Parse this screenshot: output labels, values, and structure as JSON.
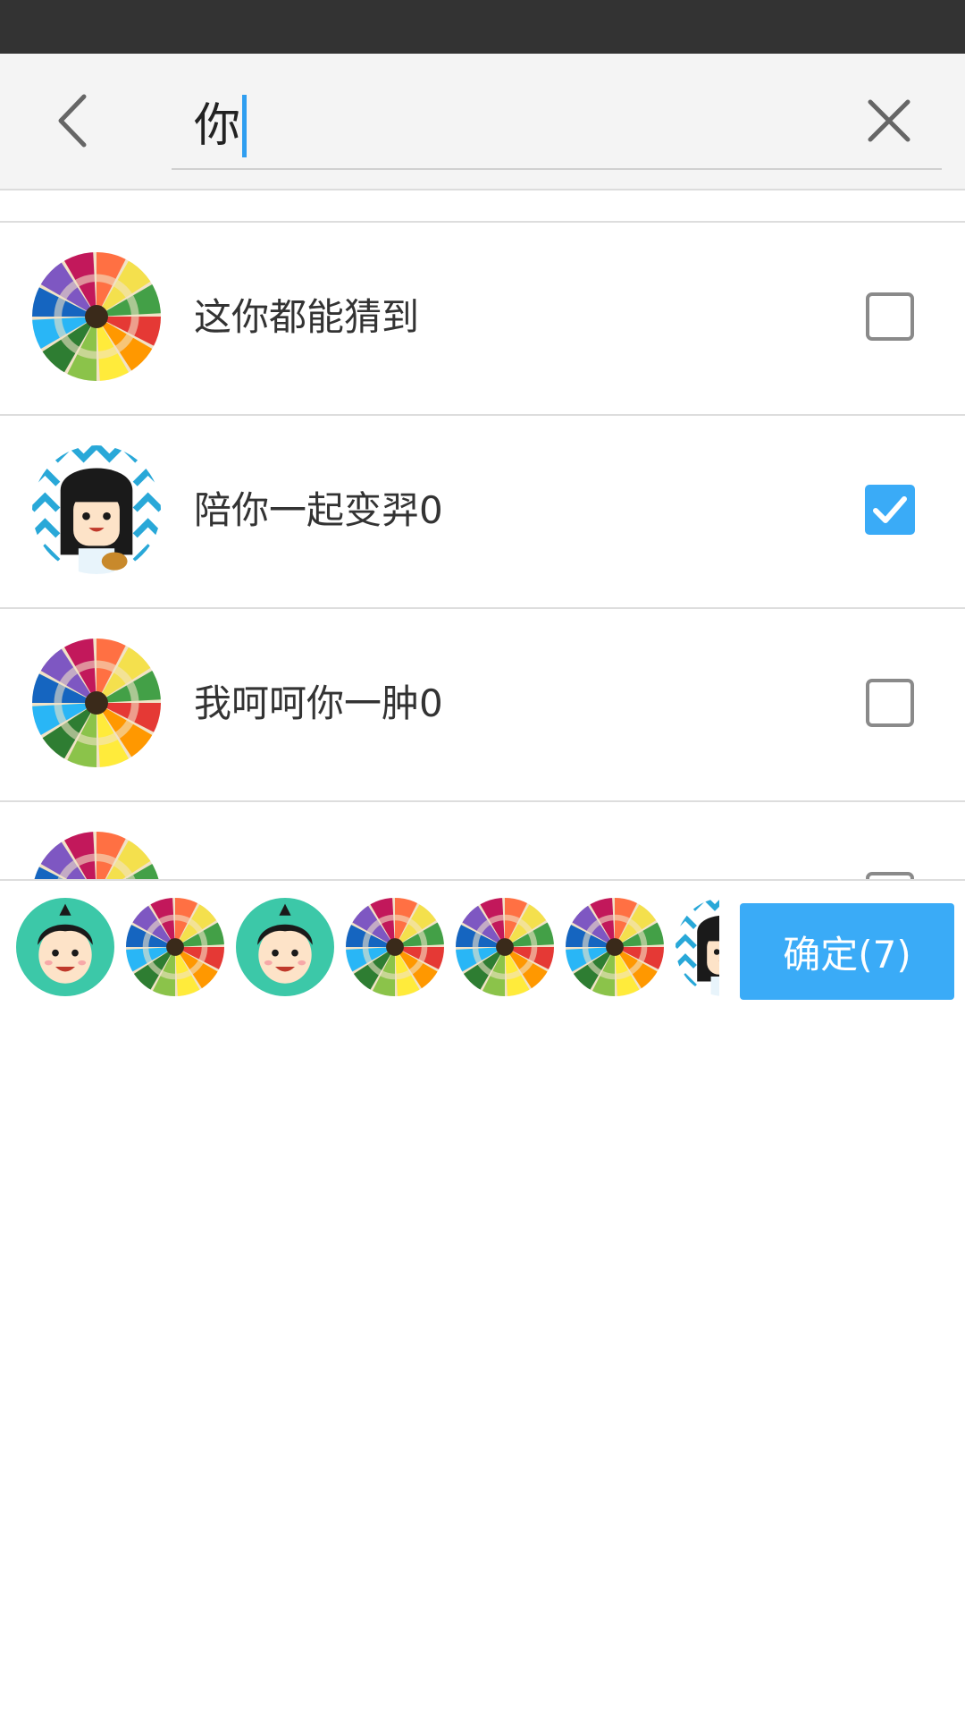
{
  "search": {
    "value": "你"
  },
  "results": [
    {
      "name": "这你都能猜到",
      "avatar": "pencil-wheel-avatar",
      "checked": false
    },
    {
      "name": "陪你一起变羿0",
      "avatar": "cartoon-girl-avatar",
      "checked": true
    },
    {
      "name": "我呵呵你一肿0",
      "avatar": "pencil-wheel-avatar",
      "checked": false
    },
    {
      "name": "",
      "avatar": "pencil-wheel-avatar",
      "checked": false
    }
  ],
  "selected": {
    "avatars": [
      "cartoon-boy-avatar",
      "pencil-wheel-avatar",
      "cartoon-boy-avatar",
      "pencil-wheel-avatar",
      "pencil-wheel-avatar",
      "pencil-wheel-avatar",
      "cartoon-girl-avatar"
    ]
  },
  "confirm": {
    "label": "确定(7)"
  },
  "icons": {
    "back": "chevron-left-icon",
    "clear": "close-icon",
    "checkbox": "checkbox-icon"
  },
  "colors": {
    "accent": "#3aabf7",
    "status_bar": "#333333",
    "header_bg": "#f4f4f4",
    "text": "#333333",
    "checkbox_border": "#8a8a8a"
  }
}
